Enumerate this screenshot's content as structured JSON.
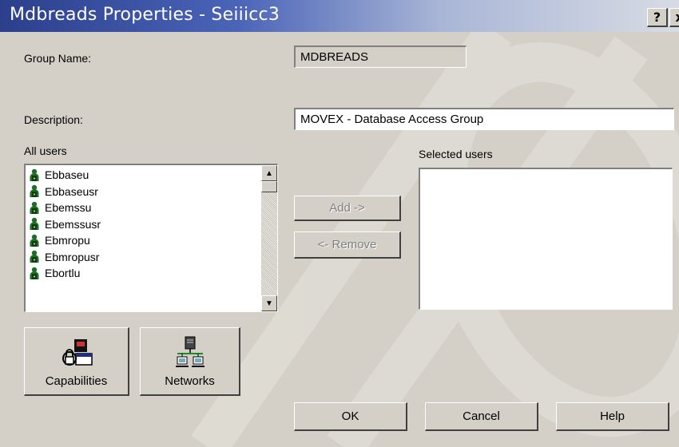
{
  "window": {
    "title": "Mdbreads Properties - Seiiicc3",
    "help_button": "?",
    "close_button": "x"
  },
  "group_name": {
    "label": "Group Name:",
    "value": "MDBREADS"
  },
  "description": {
    "label": "Description:",
    "value": "MOVEX - Database Access Group"
  },
  "all_users": {
    "label": "All users",
    "items": [
      "Ebbaseu",
      "Ebbaseusr",
      "Ebemssu",
      "Ebemssusr",
      "Ebmropu",
      "Ebmropusr",
      "Ebortlu"
    ]
  },
  "selected_users": {
    "label": "Selected users",
    "items": []
  },
  "actions": {
    "add": "Add ->",
    "remove": "<- Remove"
  },
  "tool_buttons": {
    "capabilities": "Capabilities",
    "networks": "Networks"
  },
  "footer": {
    "ok": "OK",
    "cancel": "Cancel",
    "help": "Help"
  },
  "icons": {
    "user": "user-icon",
    "capabilities": "capabilities-icon",
    "networks": "networks-icon"
  }
}
